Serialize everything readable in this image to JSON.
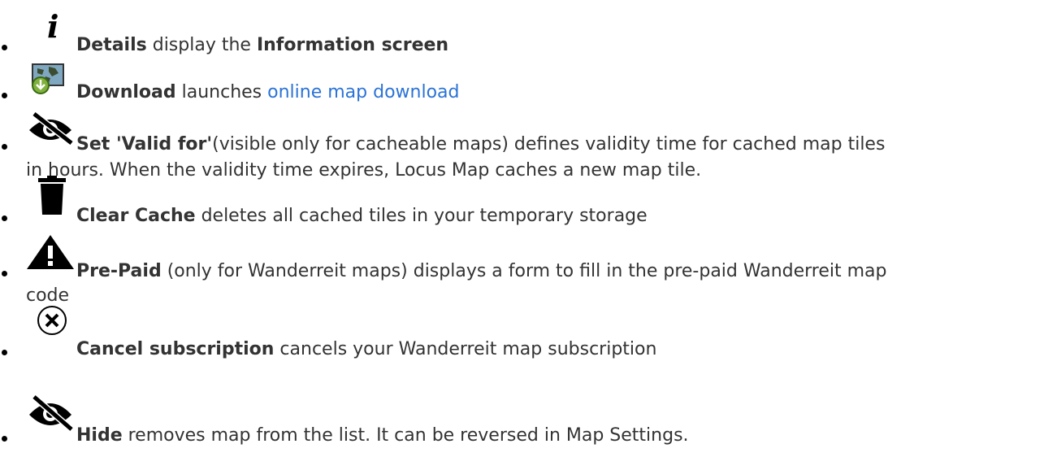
{
  "items": [
    {
      "icon": "info-icon",
      "term": "Details",
      "text1": " display the ",
      "term2": "Information screen"
    },
    {
      "icon": "map-download-icon",
      "term": "Download",
      "text1": " launches ",
      "link": "online map download"
    },
    {
      "icon": "eye-slash-icon",
      "term": "Set 'Valid for'",
      "line1": "(visible only for cacheable maps) defines validity time for cached map tiles",
      "line2": "in hours. When the validity time expires, Locus Map caches a new map tile."
    },
    {
      "icon": "trash-icon",
      "term": "Clear Cache",
      "text1": " deletes all cached tiles in your temporary storage"
    },
    {
      "icon": "warning-icon",
      "term": "Pre-Paid",
      "line1": " (only for Wanderreit maps) displays a form to fill in the pre-paid Wanderreit map",
      "line2": "code"
    },
    {
      "icon": "cancel-circle-icon",
      "term": "Cancel subscription",
      "text1": " cancels your Wanderreit map subscription"
    },
    {
      "icon": "eye-slash-icon",
      "term": "Hide",
      "text1": " removes map from the list. It can be reversed in Map Settings."
    }
  ]
}
